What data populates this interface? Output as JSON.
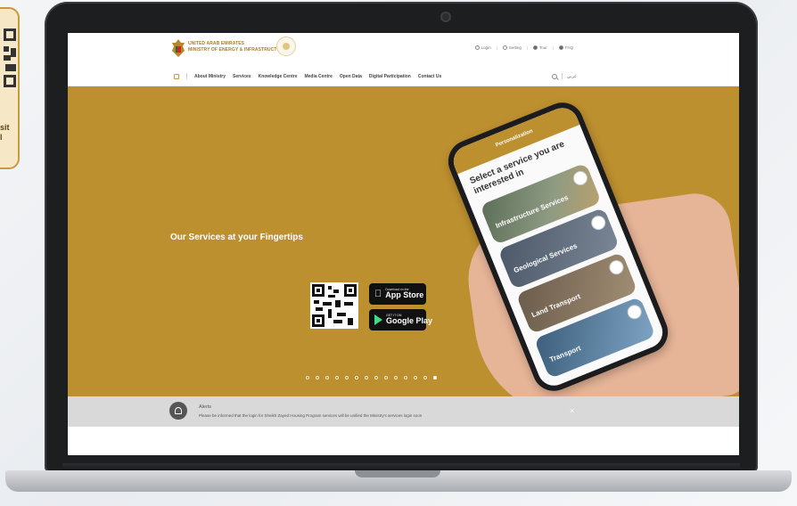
{
  "side_card": {
    "text": "sit\nl"
  },
  "header": {
    "ministry_line1": "UNITED ARAB EMIRATES",
    "ministry_line2": "MINISTRY OF ENERGY & INFRASTRUCTURE",
    "util_links": [
      "Login",
      "Setting",
      "Tour",
      "FAQ"
    ]
  },
  "nav": {
    "items": [
      "About Ministry",
      "Services",
      "Knowledge Centre",
      "Media Centre",
      "Open Data",
      "Digital Participation",
      "Contact Us"
    ],
    "language": "عربي"
  },
  "hero": {
    "title": "Our Services at your Fingertips",
    "app_store_small": "Download on the",
    "app_store_big": "App Store",
    "google_play_small": "GET IT ON",
    "google_play_big": "Google Play",
    "slide_count": 14,
    "active_slide": 14
  },
  "phone": {
    "header": "Personalization",
    "heading": "Select a service you are interested in",
    "services": [
      "Infrastructure Services",
      "Geological Services",
      "Land Transport",
      "Transport"
    ]
  },
  "alert": {
    "title": "Alerts",
    "message": "Please be informed that the login for Sheikh Zayed Housing Program services will be unified the Ministry's services login soon",
    "close": "×"
  },
  "colors": {
    "brand_gold": "#bd902f",
    "alert_gray": "#d9d9d9"
  }
}
